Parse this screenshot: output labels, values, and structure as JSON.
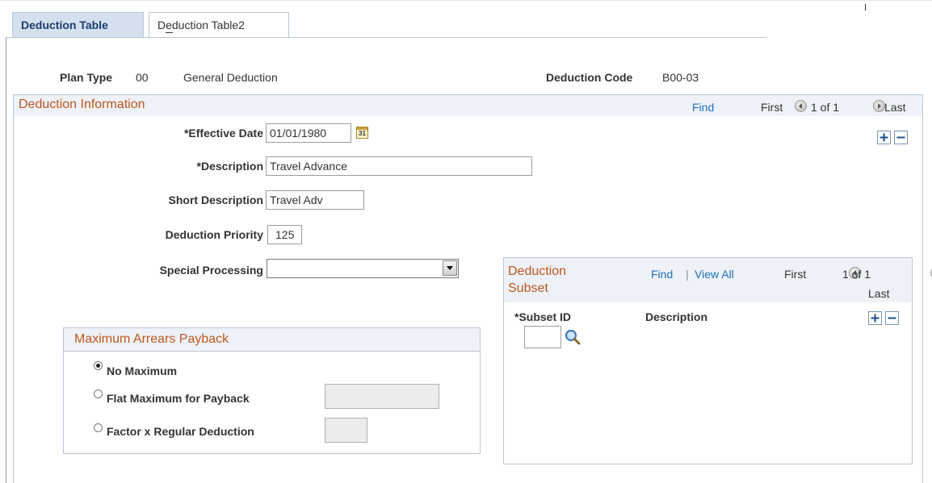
{
  "tabs": [
    {
      "label": "Deduction Table",
      "active": true
    },
    {
      "label": "Deduction Table2",
      "active": false
    }
  ],
  "header": {
    "plan_type_label": "Plan Type",
    "plan_type_code": "00",
    "plan_type_name": "General Deduction",
    "deduction_code_label": "Deduction Code",
    "deduction_code_value": "B00-03"
  },
  "deduction_info": {
    "title": "Deduction Information",
    "find": "Find",
    "first": "First",
    "count": "1 of 1",
    "last": "Last",
    "effective_date_label": "*Effective Date",
    "effective_date_value": "01/01/1980",
    "calendar_icon_text": "31",
    "description_label": "*Description",
    "description_value": "Travel Advance",
    "short_description_label": "Short Description",
    "short_description_value": "Travel Adv",
    "priority_label": "Deduction Priority",
    "priority_value": "125",
    "special_processing_label": "Special Processing",
    "special_processing_value": ""
  },
  "arrears": {
    "title": "Maximum Arrears Payback",
    "options": [
      {
        "label": "No Maximum",
        "selected": true
      },
      {
        "label": "Flat Maximum for Payback",
        "selected": false
      },
      {
        "label": "Factor x Regular Deduction",
        "selected": false
      }
    ],
    "flat_value": "",
    "factor_value": ""
  },
  "subset": {
    "title_line1": "Deduction",
    "title_line2": "Subset",
    "find": "Find",
    "separator": "|",
    "view_all": "View All",
    "first": "First",
    "count": "1 of 1",
    "last": "Last",
    "col_subset_id": "*Subset ID",
    "col_description": "Description",
    "subset_id_value": ""
  },
  "colors": {
    "section_title": "#c0561c",
    "link": "#1f6fbf",
    "tab_active_bg": "#d4e0ee",
    "section_header_bg": "#eef2f8",
    "border": "#b9c7d8"
  }
}
